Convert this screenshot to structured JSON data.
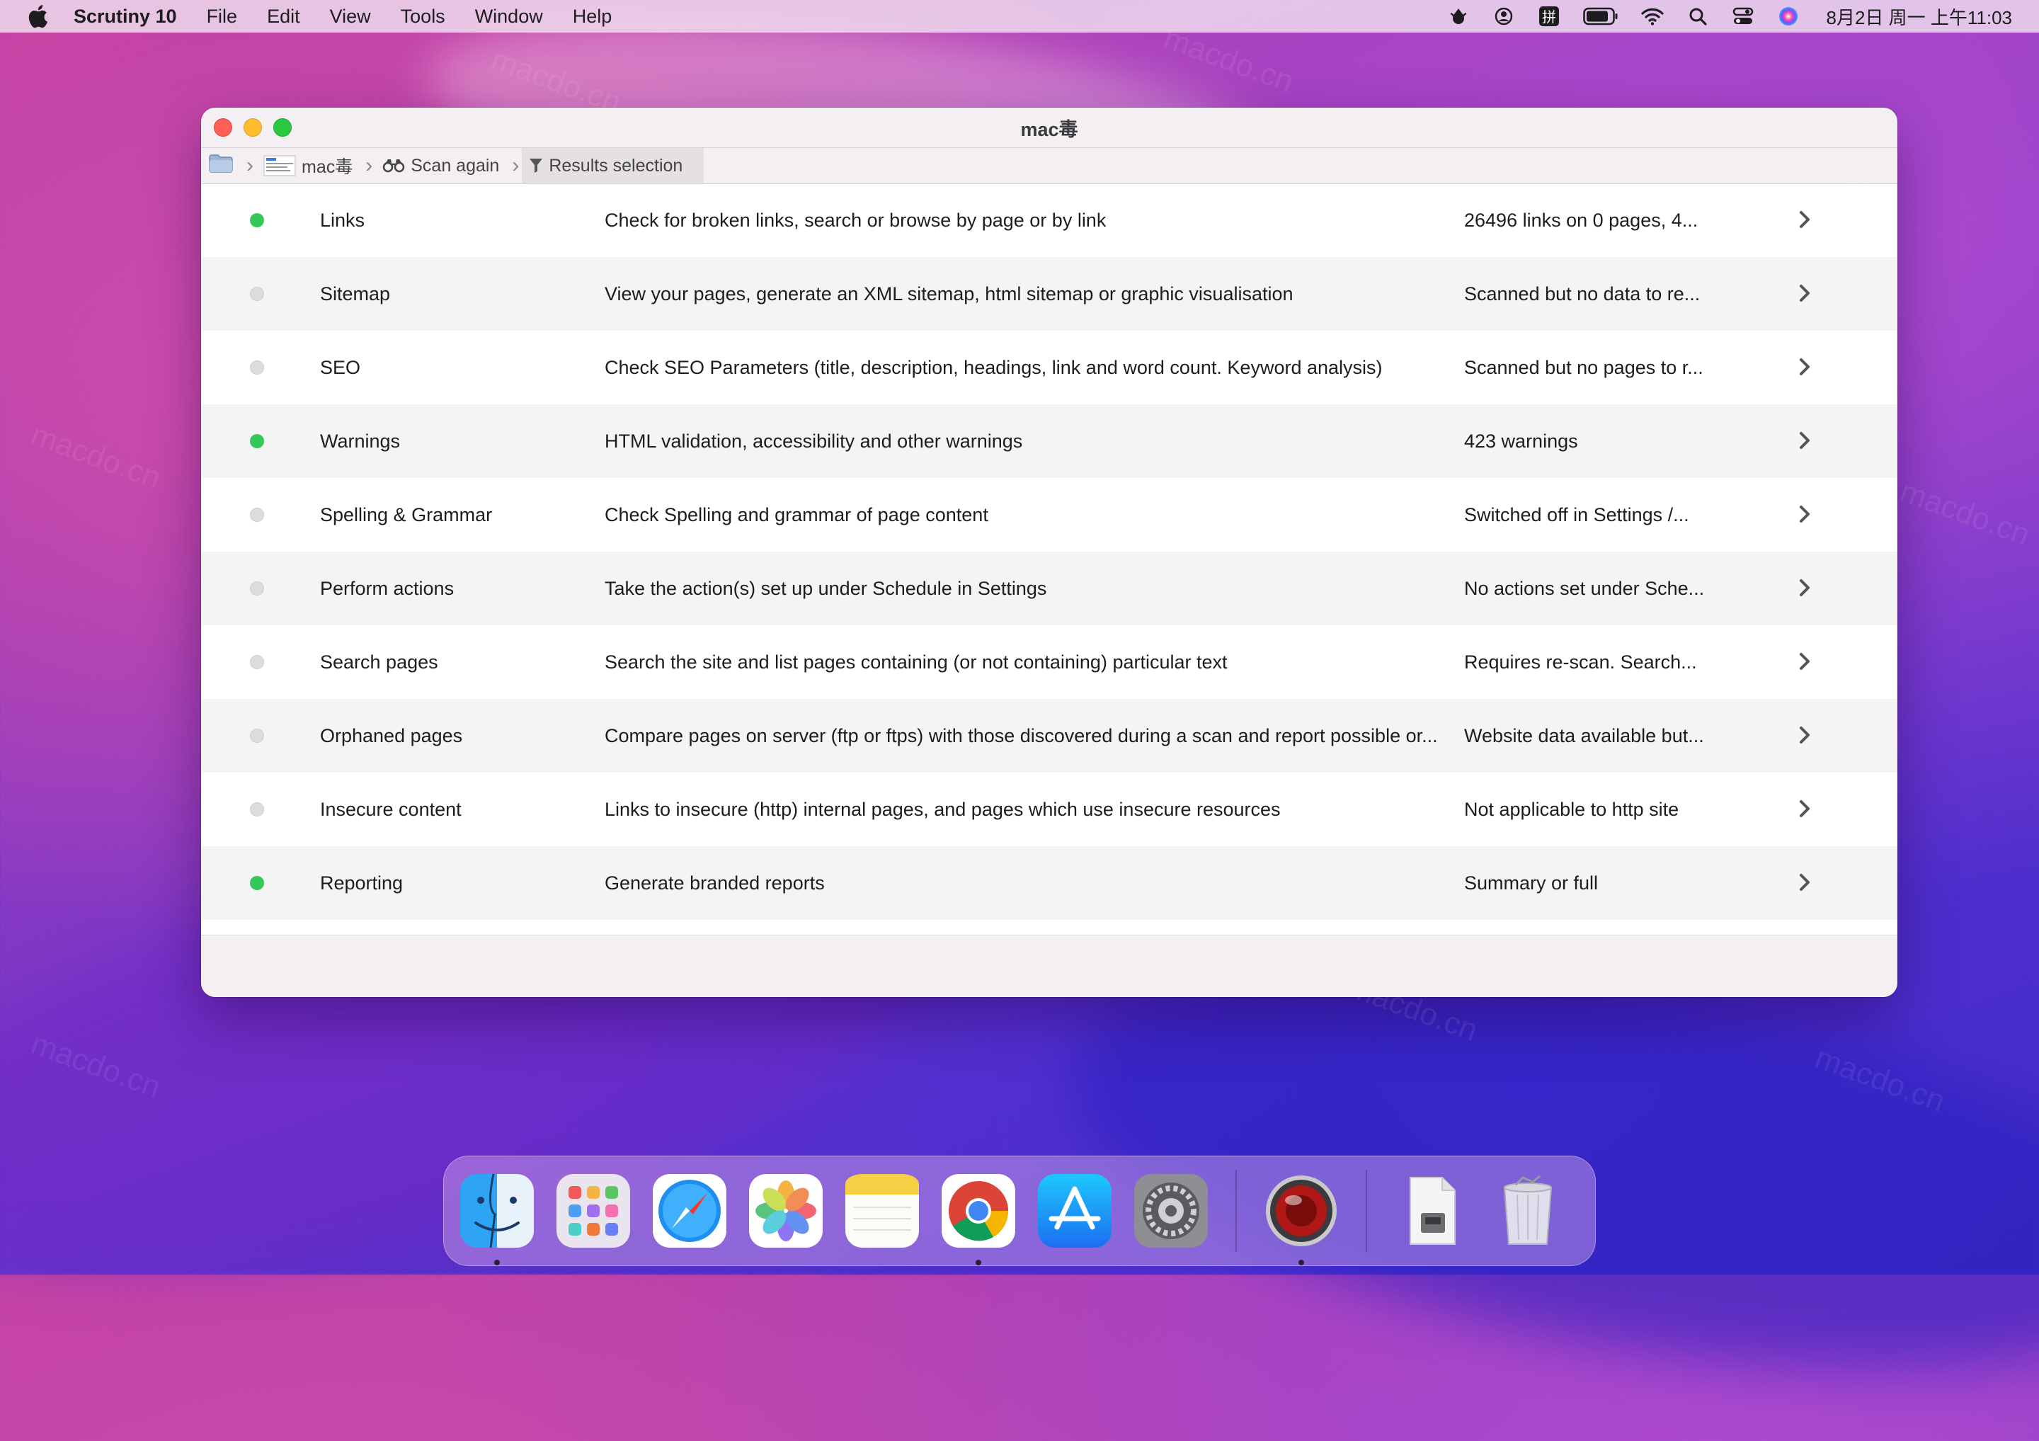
{
  "menubar": {
    "app_name": "Scrutiny 10",
    "items": [
      "File",
      "Edit",
      "View",
      "Tools",
      "Window",
      "Help"
    ],
    "clock": "8月2日 周一 上午11:03",
    "status_icons": [
      "vpn-icon",
      "user-icon",
      "input-method-icon",
      "battery-icon",
      "wifi-icon",
      "spotlight-icon",
      "control-center-icon",
      "siri-icon"
    ]
  },
  "window": {
    "title": "mac毒",
    "breadcrumb": {
      "site_label": "mac毒",
      "scan_again": "Scan again",
      "results_selection": "Results selection"
    },
    "rows": [
      {
        "name": "Links",
        "description": "Check for broken links, search or browse by page or by link",
        "status": "26496 links on 0 pages, 4...",
        "enabled": true
      },
      {
        "name": "Sitemap",
        "description": "View your pages, generate an XML sitemap, html sitemap or graphic visualisation",
        "status": "Scanned but no data to re...",
        "enabled": false
      },
      {
        "name": "SEO",
        "description": "Check SEO Parameters (title, description, headings, link and word count. Keyword analysis)",
        "status": "Scanned but no pages to r...",
        "enabled": false
      },
      {
        "name": "Warnings",
        "description": "HTML validation, accessibility and other warnings",
        "status": "423 warnings",
        "enabled": true
      },
      {
        "name": "Spelling & Grammar",
        "description": "Check Spelling and grammar of page content",
        "status": "Switched off in Settings /...",
        "enabled": false
      },
      {
        "name": "Perform actions",
        "description": "Take the action(s) set up under Schedule in Settings",
        "status": "No actions set under Sche...",
        "enabled": false
      },
      {
        "name": "Search pages",
        "description": "Search the site and list pages containing (or not containing) particular text",
        "status": "Requires re-scan. Search...",
        "enabled": false
      },
      {
        "name": "Orphaned pages",
        "description": "Compare pages on server (ftp or ftps) with those discovered during a scan and report possible or...",
        "status": "Website data available but...",
        "enabled": false
      },
      {
        "name": "Insecure content",
        "description": "Links to insecure (http) internal pages, and pages which use insecure resources",
        "status": "Not applicable to http site",
        "enabled": false
      },
      {
        "name": "Reporting",
        "description": "Generate branded reports",
        "status": "Summary or full",
        "enabled": true
      }
    ]
  },
  "dock": {
    "apps": [
      "finder-icon",
      "launchpad-icon",
      "safari-icon",
      "photos-icon",
      "notes-icon",
      "chrome-icon",
      "app-store-icon",
      "system-preferences-icon",
      "scrutiny-icon",
      "archive-file-icon",
      "trash-icon"
    ]
  },
  "watermark": "macdo.cn",
  "colors": {
    "enabled_dot": "#34c759",
    "disabled_dot": "#dcdcdc",
    "close": "#fe5f57",
    "minimize": "#febc2e",
    "maximize": "#28c840"
  }
}
